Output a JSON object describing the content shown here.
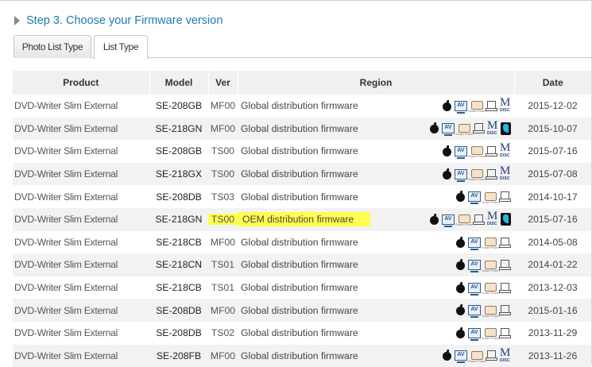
{
  "step": {
    "title": "Step 3. Choose your Firmware version"
  },
  "tabs": [
    {
      "label": "Photo List Type"
    },
    {
      "label": "List Type"
    }
  ],
  "table": {
    "headers": {
      "product": "Product",
      "model": "Model",
      "ver": "Ver",
      "region": "Region",
      "date": "Date"
    },
    "rows": [
      {
        "product": "DVD-Writer Slim External",
        "model": "SE-208GB",
        "ver": "MF00",
        "region": "Global distribution firmware",
        "date": "2015-12-02",
        "icons": [
          "apple-icon",
          "av-icon",
          "smart-power-icon",
          "smart-fw-icon",
          "m-disc-icon"
        ]
      },
      {
        "product": "DVD-Writer Slim External",
        "model": "SE-218GN",
        "ver": "MF00",
        "region": "Global distribution firmware",
        "date": "2015-10-07",
        "icons": [
          "apple-icon",
          "av-icon",
          "smart-power-icon",
          "smart-fw-icon",
          "m-disc-icon",
          "ultra-icon"
        ]
      },
      {
        "product": "DVD-Writer Slim External",
        "model": "SE-208GB",
        "ver": "TS00",
        "region": "Global distribution firmware",
        "date": "2015-07-16",
        "icons": [
          "apple-icon",
          "av-icon",
          "smart-power-icon",
          "smart-fw-icon",
          "m-disc-icon"
        ]
      },
      {
        "product": "DVD-Writer Slim External",
        "model": "SE-218GX",
        "ver": "TS00",
        "region": "Global distribution firmware",
        "date": "2015-07-08",
        "icons": [
          "apple-icon",
          "av-icon",
          "smart-power-icon",
          "smart-fw-icon",
          "m-disc-icon"
        ]
      },
      {
        "product": "DVD-Writer Slim External",
        "model": "SE-208DB",
        "ver": "TS03",
        "region": "Global distribution firmware",
        "date": "2014-10-17",
        "icons": [
          "apple-icon",
          "av-icon",
          "smart-power-icon",
          "smart-fw-icon"
        ]
      },
      {
        "product": "DVD-Writer Slim External",
        "model": "SE-218GN",
        "ver": "TS00",
        "region": "OEM distribution firmware",
        "date": "2015-07-16",
        "icons": [
          "apple-icon",
          "av-icon",
          "smart-power-icon",
          "smart-fw-icon",
          "m-disc-icon",
          "ultra-icon"
        ],
        "highlight": true
      },
      {
        "product": "DVD-Writer Slim External",
        "model": "SE-218CB",
        "ver": "MF00",
        "region": "Global distribution firmware",
        "date": "2014-05-08",
        "icons": [
          "apple-icon",
          "av-icon",
          "smart-power-icon",
          "smart-fw-icon"
        ]
      },
      {
        "product": "DVD-Writer Slim External",
        "model": "SE-218CN",
        "ver": "TS01",
        "region": "Global distribution firmware",
        "date": "2014-01-22",
        "icons": [
          "apple-icon",
          "av-icon",
          "smart-power-icon",
          "smart-fw-icon"
        ]
      },
      {
        "product": "DVD-Writer Slim External",
        "model": "SE-218CB",
        "ver": "TS01",
        "region": "Global distribution firmware",
        "date": "2013-12-03",
        "icons": [
          "apple-icon",
          "av-icon",
          "smart-power-icon",
          "smart-fw-icon"
        ]
      },
      {
        "product": "DVD-Writer Slim External",
        "model": "SE-208DB",
        "ver": "MF00",
        "region": "Global distribution firmware",
        "date": "2015-01-16",
        "icons": [
          "apple-icon",
          "av-icon",
          "smart-power-icon",
          "smart-fw-icon"
        ]
      },
      {
        "product": "DVD-Writer Slim External",
        "model": "SE-208DB",
        "ver": "TS02",
        "region": "Global distribution firmware",
        "date": "2013-11-29",
        "icons": [
          "apple-icon",
          "av-icon",
          "smart-power-icon",
          "smart-fw-icon"
        ]
      },
      {
        "product": "DVD-Writer Slim External",
        "model": "SE-208FB",
        "ver": "MF00",
        "region": "Global distribution firmware",
        "date": "2013-11-26",
        "icons": [
          "apple-icon",
          "av-icon",
          "smart-power-icon",
          "smart-fw-icon",
          "m-disc-icon"
        ]
      }
    ]
  },
  "colors": {
    "accent": "#1f7ab0",
    "highlight": "#ffff4d",
    "row_alt": "#f2f2f2",
    "header_bg": "#f0f0f0"
  }
}
